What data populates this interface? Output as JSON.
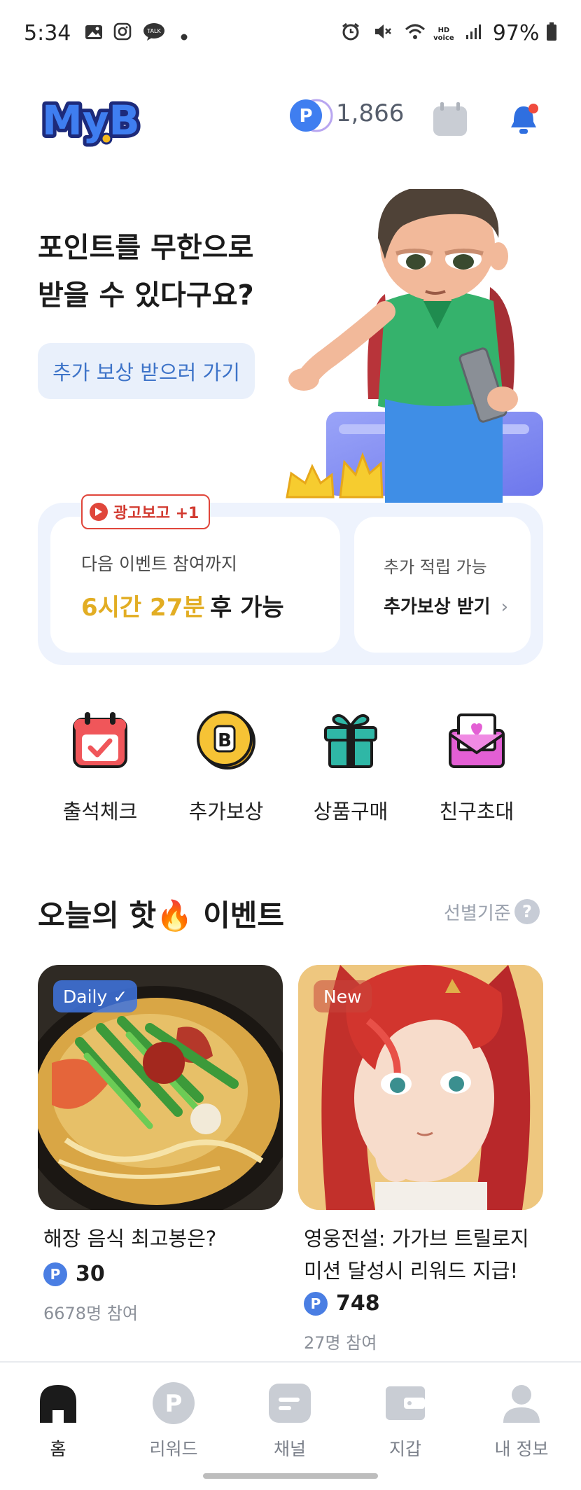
{
  "status_bar": {
    "time": "5:34",
    "battery": "97%"
  },
  "header": {
    "logo_text": "MyB",
    "points": "1,866"
  },
  "hero": {
    "title_line1": "포인트를 무한으로",
    "title_line2": "받을 수 있다구요?",
    "button": "추가 보상 받으러 가기"
  },
  "info_card": {
    "ad_badge": "광고보고 +1",
    "next_label": "다음 이벤트 참여까지",
    "timer": "6시간 27분",
    "after": "후 가능",
    "extra_label": "추가 적립 가능",
    "extra_button": "추가보상 받기",
    "extra_chevron": "›"
  },
  "quick_menu": [
    {
      "label": "출석체크",
      "icon": "calendar-check-icon"
    },
    {
      "label": "추가보상",
      "icon": "coin-b-icon"
    },
    {
      "label": "상품구매",
      "icon": "gift-icon"
    },
    {
      "label": "친구초대",
      "icon": "mail-heart-icon"
    }
  ],
  "section": {
    "title": "오늘의 핫🔥 이벤트",
    "sort": "선별기준",
    "help": "?"
  },
  "events": [
    {
      "tag": "Daily ✓",
      "title": "해장 음식 최고봉은?",
      "points": "30",
      "participants": "6678명 참여"
    },
    {
      "tag": "New",
      "title_line1": "영웅전설: 가가브 트릴로지",
      "title_line2": "미션 달성시 리워드 지급!",
      "points": "748",
      "participants": "27명 참여"
    }
  ],
  "point_badge": "P",
  "bottom_nav": [
    {
      "label": "홈",
      "icon": "home-icon"
    },
    {
      "label": "리워드",
      "icon": "reward-p-icon"
    },
    {
      "label": "채널",
      "icon": "channel-icon"
    },
    {
      "label": "지갑",
      "icon": "wallet-icon"
    },
    {
      "label": "내 정보",
      "icon": "profile-icon"
    }
  ],
  "colors": {
    "accent": "#4a7ee3",
    "timer": "#e2ad23",
    "ad_red": "#e0463b"
  }
}
